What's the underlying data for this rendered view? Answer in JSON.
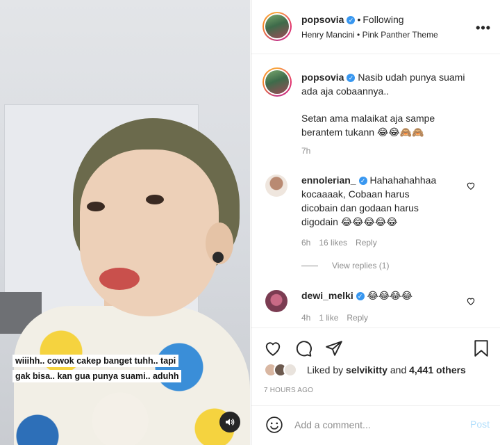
{
  "post": {
    "author": "popsovia",
    "follow_status": "Following",
    "audio": "Henry Mancini • Pink Panther Theme",
    "caption_line1": "Nasib udah punya suami",
    "caption_line2": "ada aja cobaannya..",
    "caption_line3": "Setan ama malaikat aja sampe",
    "caption_line4": "berantem tukann 😂😂🙈🙈",
    "caption_time": "7h"
  },
  "video": {
    "overlay_line1": "wiiihh.. cowok cakep banget tuhh.. tapi",
    "overlay_line2": "gak bisa.. kan gua punya suami.. aduhh"
  },
  "comments": [
    {
      "username": "ennolerian_",
      "line1": "Hahahahahhaa",
      "line2": "kocaaaak, Cobaan harus",
      "line3": "dicobain dan godaan harus",
      "line4": "digodain 😂😂😂😂😂",
      "time": "6h",
      "likes": "16 likes",
      "reply": "Reply",
      "view_replies": "View replies (1)"
    },
    {
      "username": "dewi_melki",
      "text": "😂😂😂😂",
      "time": "4h",
      "likes": "1 like",
      "reply": "Reply"
    }
  ],
  "likes": {
    "prefix": "Liked by",
    "user": "selvikitty",
    "suffix": "and",
    "others": "4,441 others"
  },
  "time_ago": "7 HOURS AGO",
  "comment_box": {
    "placeholder": "Add a comment...",
    "post_label": "Post"
  },
  "icons": {
    "more": "more-icon",
    "heart": "heart-icon",
    "comment": "comment-icon",
    "share": "share-icon",
    "save": "bookmark-icon",
    "emoji": "emoji-icon",
    "sound": "speaker-icon"
  },
  "colors": {
    "verified": "#3897f0",
    "muted": "#8e8e8e",
    "post_disabled": "#b2dffc"
  }
}
